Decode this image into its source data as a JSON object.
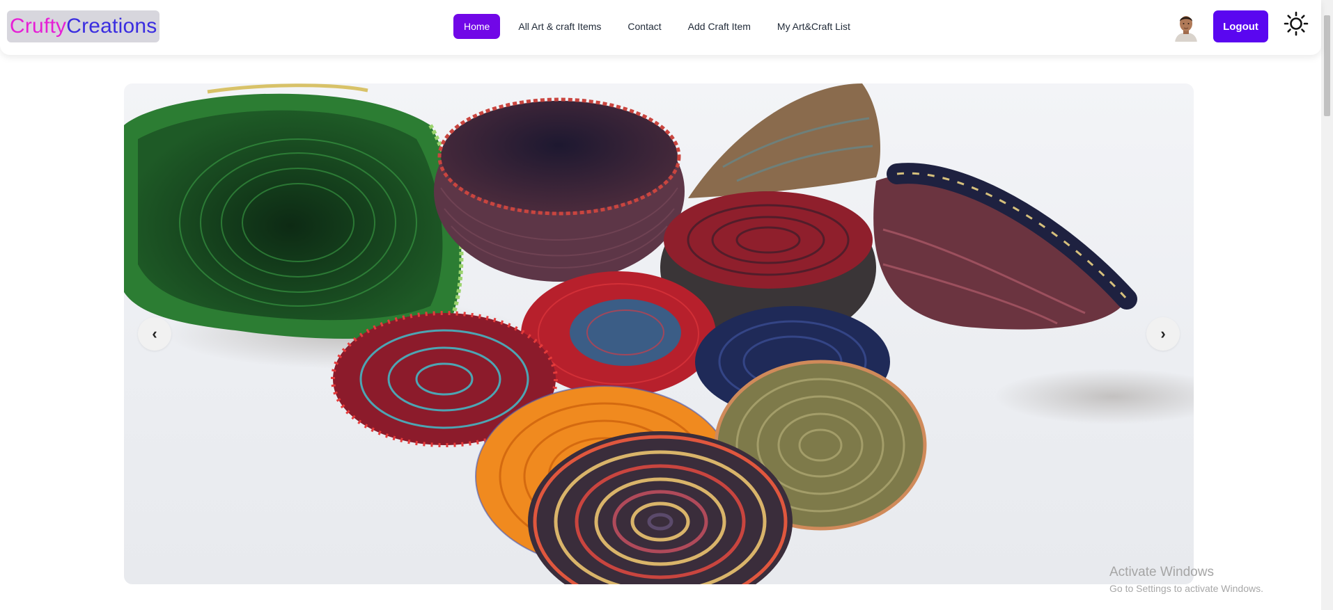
{
  "brand": {
    "part1": "Crufty",
    "part2": "Creations",
    "colors": {
      "part1": "#e61fd6",
      "part2": "#3a2de0",
      "background": "#d7d6dd"
    }
  },
  "nav": {
    "items": [
      {
        "label": "Home",
        "active": true
      },
      {
        "label": "All Art & craft Items",
        "active": false
      },
      {
        "label": "Contact",
        "active": false
      },
      {
        "label": "Add Craft Item",
        "active": false
      },
      {
        "label": "My Art&Craft List",
        "active": false
      }
    ],
    "active_color": "#7107e7"
  },
  "user": {
    "avatar_icon": "user-avatar-photo",
    "logout_label": "Logout",
    "logout_color": "#5a07f0",
    "theme_icon": "sun-icon"
  },
  "carousel": {
    "slide_icon": "woven-baskets-photo",
    "prev_label": "‹",
    "next_label": "›"
  },
  "watermark": {
    "line1": "Activate Windows",
    "line2": "Go to Settings to activate Windows."
  }
}
